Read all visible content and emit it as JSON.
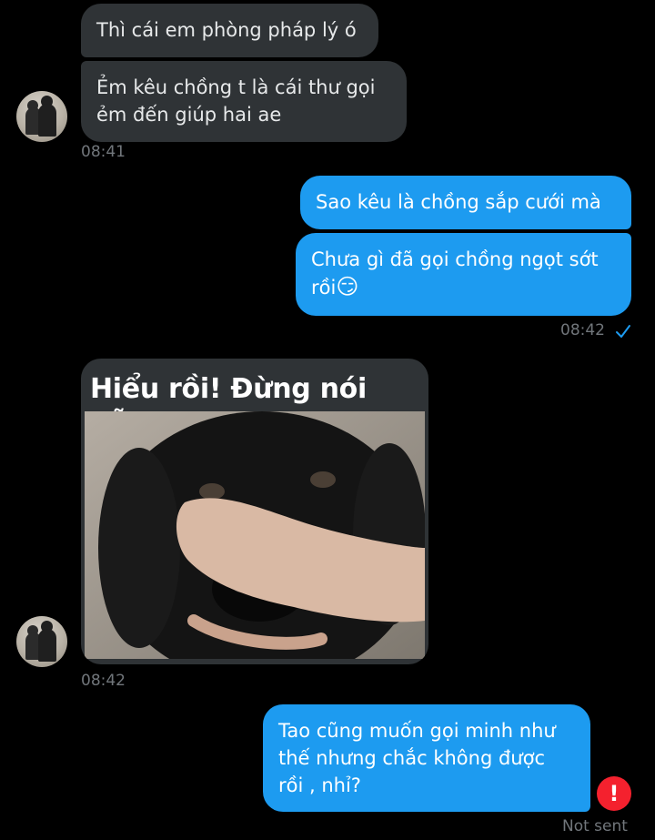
{
  "messages": {
    "m1": "Thì cái em phòng pháp lý ó",
    "m2_line1": "Ẻm kêu chồng t là cái thư gọi",
    "m2_line2": "ẻm đến giúp hai ae",
    "t1": "08:41",
    "m3": "Sao kêu là chồng sắp cưới mà",
    "m4_line1": "Chưa gì đã gọi chồng ngọt sớt",
    "m4_line2": "rồi",
    "m4_emoji": "😏",
    "t2": "08:42",
    "media_caption": "Hiểu rồi! Đừng nói nữa",
    "t3": "08:42",
    "m5_line1": "Tao cũng muốn gọi minh như",
    "m5_line2": "thế nhưng chắc không được",
    "m5_line3": "rồi , nhỉ?",
    "error_icon": "!",
    "status": "Not sent"
  },
  "colors": {
    "background": "#000000",
    "incoming_bubble": "#2f3336",
    "outgoing_bubble": "#1d9bf0",
    "timestamp": "#71767b",
    "error": "#f4212e"
  },
  "icons": {
    "read_check": "check-icon",
    "error": "error-icon"
  }
}
